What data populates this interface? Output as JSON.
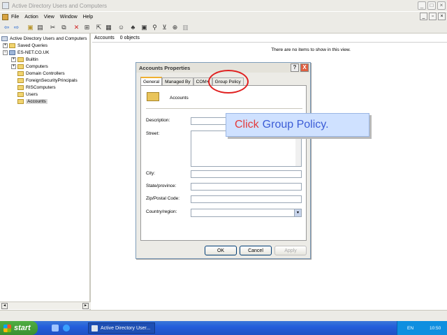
{
  "window": {
    "title": "Active Directory Users and Computers"
  },
  "menu": [
    "File",
    "Action",
    "View",
    "Window",
    "Help"
  ],
  "tree": {
    "root": "Active Directory Users and Computers",
    "items": [
      {
        "label": "Saved Queries"
      },
      {
        "label": "ES-NET.CO.UK"
      },
      {
        "label": "Builtin"
      },
      {
        "label": "Computers"
      },
      {
        "label": "Domain Controllers"
      },
      {
        "label": "ForeignSecurityPrincipals"
      },
      {
        "label": "RISComputers"
      },
      {
        "label": "Users"
      },
      {
        "label": "Accounts"
      }
    ]
  },
  "list": {
    "header_name": "Accounts",
    "header_count": "0 objects",
    "empty_message": "There are no items to show in this view."
  },
  "dialog": {
    "title": "Accounts Properties",
    "help": "?",
    "close": "X",
    "tabs": [
      "General",
      "Managed By",
      "COM+",
      "Group Policy"
    ],
    "object_name": "Accounts",
    "fields": {
      "description": "Description:",
      "street": "Street:",
      "city": "City:",
      "state": "State/province:",
      "zip": "Zip/Postal Code:",
      "country": "Country/region:"
    },
    "buttons": {
      "ok": "OK",
      "cancel": "Cancel",
      "apply": "Apply"
    }
  },
  "callout": {
    "part1": "Click",
    "part2": "Group Policy."
  },
  "taskbar": {
    "start": "start",
    "task": "Active Directory User...",
    "lang": "EN",
    "clock": "10:50"
  },
  "colors": {
    "highlight": "#e02020",
    "callout_red": "#e33a3a",
    "callout_blue": "#3b5cd6"
  }
}
